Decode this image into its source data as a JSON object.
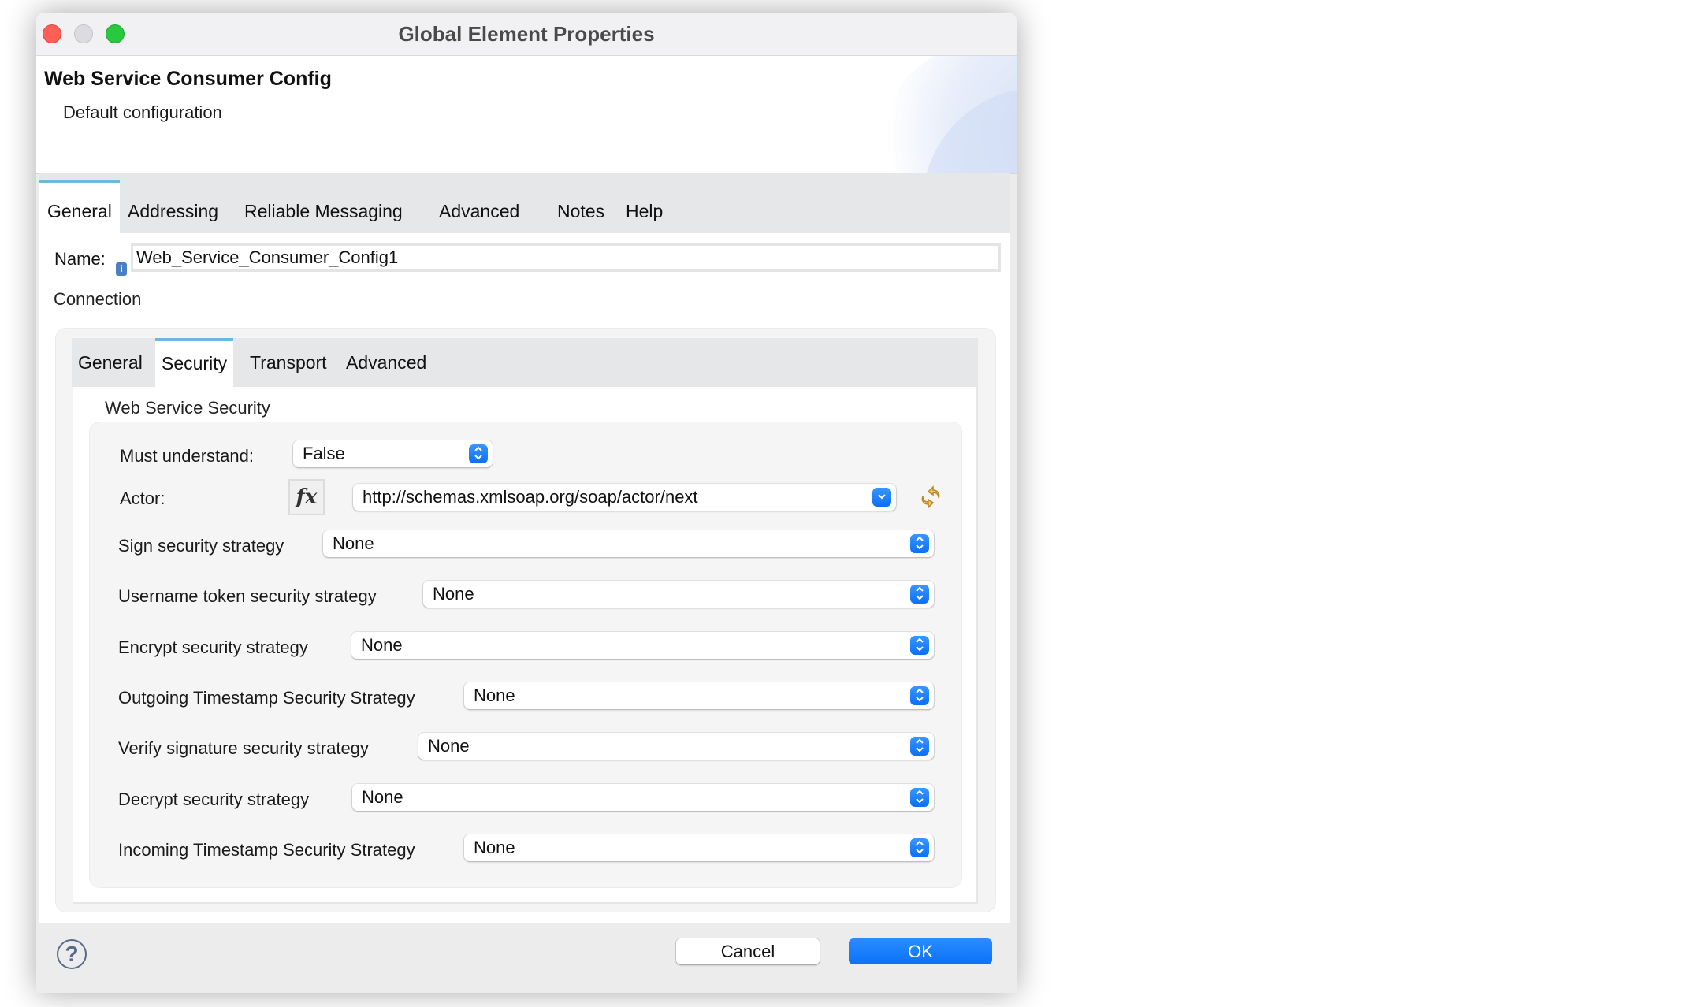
{
  "window": {
    "title": "Global Element Properties"
  },
  "header": {
    "title": "Web Service Consumer Config",
    "subtitle": "Default configuration"
  },
  "main_tabs": [
    {
      "label": "General",
      "active": true
    },
    {
      "label": "Addressing",
      "active": false
    },
    {
      "label": "Reliable Messaging",
      "active": false
    },
    {
      "label": "Advanced",
      "active": false
    },
    {
      "label": "Notes",
      "active": false
    },
    {
      "label": "Help",
      "active": false
    }
  ],
  "general": {
    "name_label": "Name:",
    "name_value": "Web_Service_Consumer_Config1",
    "info_icon": "info-icon",
    "connection_label": "Connection"
  },
  "connection_tabs": [
    {
      "label": "General",
      "active": false
    },
    {
      "label": "Security",
      "active": true
    },
    {
      "label": "Transport",
      "active": false
    },
    {
      "label": "Advanced",
      "active": false
    }
  ],
  "security": {
    "section_label": "Web Service Security",
    "must_understand": {
      "label": "Must understand:",
      "value": "False"
    },
    "actor": {
      "label": "Actor:",
      "value": "http://schemas.xmlsoap.org/soap/actor/next",
      "fx_label": "fx"
    },
    "strategies": [
      {
        "label": "Sign security strategy",
        "value": "None"
      },
      {
        "label": "Username token security strategy",
        "value": "None"
      },
      {
        "label": "Encrypt security strategy",
        "value": "None"
      },
      {
        "label": "Outgoing Timestamp Security Strategy",
        "value": "None"
      },
      {
        "label": "Verify signature security strategy",
        "value": "None"
      },
      {
        "label": "Decrypt security strategy",
        "value": "None"
      },
      {
        "label": "Incoming Timestamp Security Strategy",
        "value": "None"
      }
    ]
  },
  "footer": {
    "help_icon": "?",
    "cancel_label": "Cancel",
    "ok_label": "OK"
  },
  "colors": {
    "accent": "#0a72f7",
    "tab_indicator": "#6bb8e0",
    "close": "#fe5f57",
    "maximize": "#28c840"
  }
}
